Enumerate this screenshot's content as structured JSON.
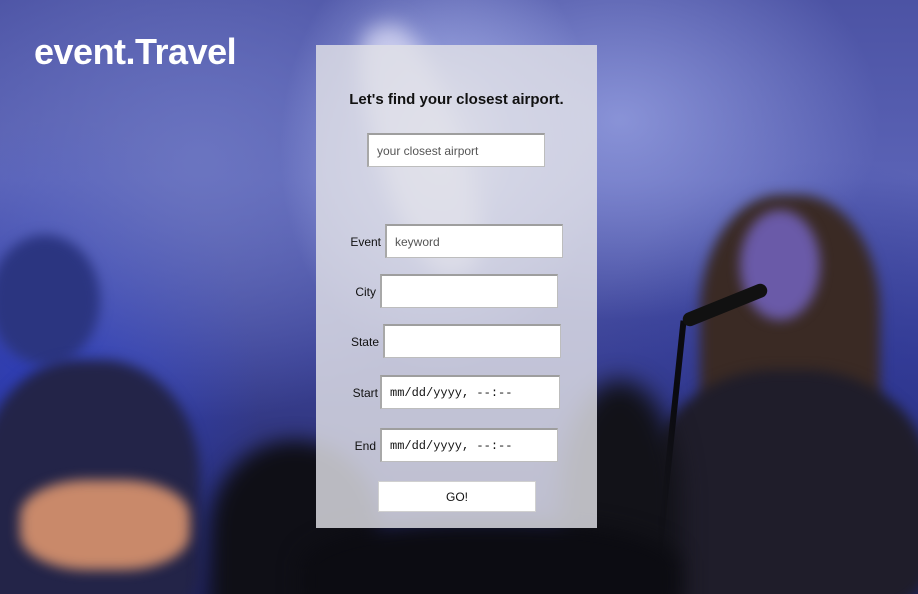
{
  "brand": {
    "logo_text": "event.Travel"
  },
  "panel": {
    "title": "Let's find your closest airport.",
    "airport_input": {
      "placeholder": "your closest airport",
      "value": ""
    },
    "event": {
      "label": "Event",
      "placeholder": "keyword",
      "value": ""
    },
    "city": {
      "label": "City",
      "value": ""
    },
    "state": {
      "label": "State",
      "value": ""
    },
    "start": {
      "label": "Start",
      "value": "mm/dd/yyyy, --:--"
    },
    "end": {
      "label": "End",
      "value": "mm/dd/yyyy, --:--"
    },
    "submit_label": "GO!"
  }
}
